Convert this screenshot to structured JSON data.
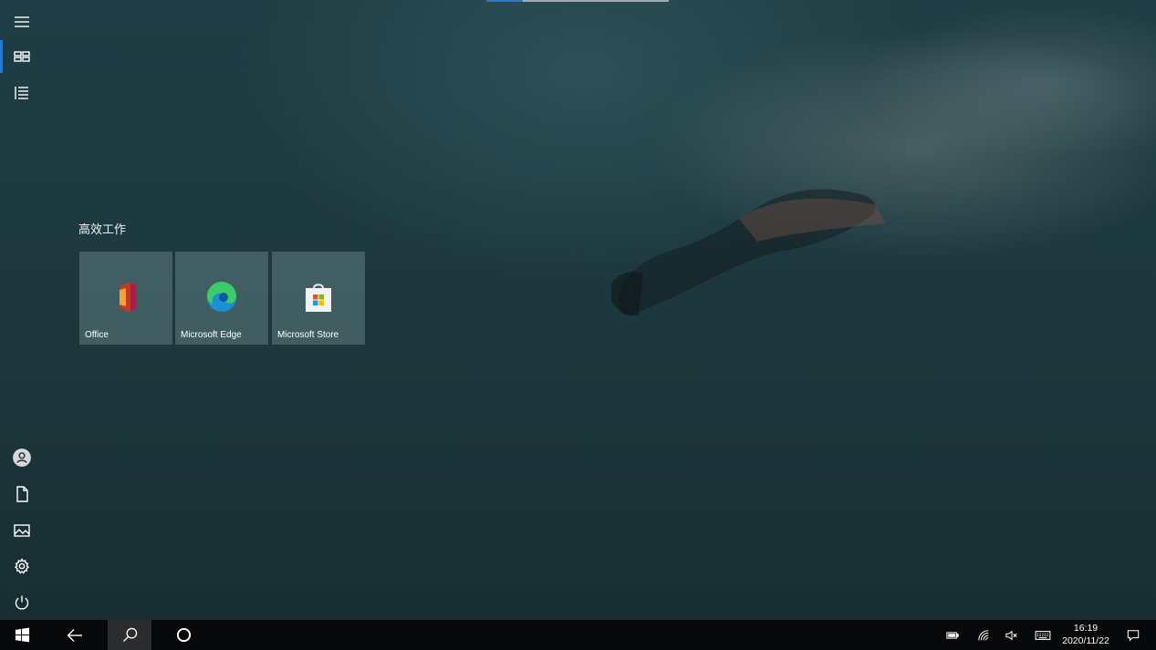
{
  "start": {
    "group_title": "高效工作",
    "tiles": [
      {
        "label": "Office",
        "icon": "office-icon"
      },
      {
        "label": "Microsoft Edge",
        "icon": "edge-icon"
      },
      {
        "label": "Microsoft Store",
        "icon": "store-icon"
      }
    ]
  },
  "rail": {
    "top_items": [
      "hamburger-icon",
      "tiles-view-icon",
      "list-view-icon"
    ],
    "bottom_items": [
      "user-icon",
      "documents-icon",
      "pictures-icon",
      "settings-icon",
      "power-icon"
    ]
  },
  "taskbar": {
    "buttons": [
      "windows-start-icon",
      "back-icon",
      "search-icon",
      "cortana-icon"
    ],
    "tray": [
      "battery-icon",
      "network-icon",
      "volume-muted-icon",
      "keyboard-icon",
      "notification-icon"
    ],
    "time": "16:19",
    "date": "2020/11/22"
  },
  "colors": {
    "accent": "#2b78d0",
    "taskbar": "#060809",
    "tile": "#5f7d82"
  }
}
